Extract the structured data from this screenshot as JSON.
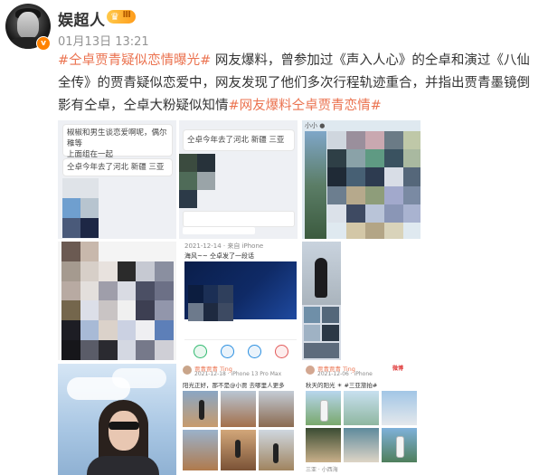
{
  "user": {
    "name": "娱超人",
    "level": "Ⅲ",
    "verified_mark": "v"
  },
  "post": {
    "time": "01月13日 13:21",
    "tag_open": "#仝卓贾青疑似恋情曝光#",
    "body_text": " 网友爆料，曾参加过《声入人心》的仝卓和演过《八仙全传》的贾青疑似恋爱中，网友发现了他们多次行程轨迹重合，并指出贾青墨镜倒影有仝卓，仝卓大粉疑似知情",
    "tag_close": "#网友爆料仝卓贾青恋情#"
  },
  "images": {
    "img1": {
      "line1": "椒椒和男生谈恋爱啊呢，偶尔稚等",
      "line2": "上面组在一起",
      "line3": "仝卓今年去了河北 新疆 三亚"
    },
    "img2": {
      "line1": "仝卓今年去了河北 新疆 三亚"
    },
    "img3": {
      "header_text": "小小 ●"
    },
    "img5": {
      "line1": "2021-12-14 · 来自 iPhone",
      "line2": "海风~~ 仝卓发了一段话"
    },
    "img8": {
      "user": "贾青贾青 Ting",
      "meta": "2021-12-18 · iPhone 13 Pro Max",
      "caption": "阳光正好，那不是@小贾 去哪里人更多"
    },
    "img9": {
      "user": "贾青贾青 Ting",
      "meta": "2021-12-06 · iPhone",
      "caption": "秋天的阳光 ☀ #三亚旅拍#",
      "watermark": "微博",
      "footer": "三亚 · 小西海"
    }
  },
  "colors": {
    "tag": "#eb7350",
    "text": "#333333",
    "time": "#939393",
    "badge": "#ff8200",
    "level_bg": "#ffb233"
  }
}
